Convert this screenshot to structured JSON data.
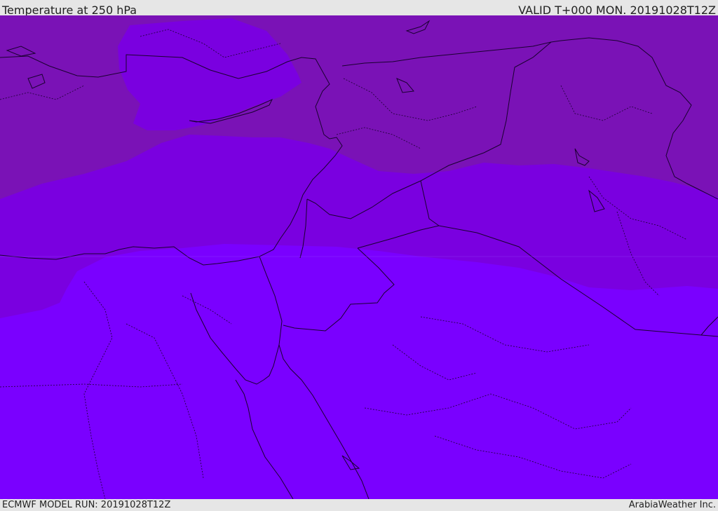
{
  "header": {
    "title": "Temperature at 250 hPa",
    "valid": "VALID T+000 MON. 20191028T12Z"
  },
  "footer": {
    "model_run": "ECMWF MODEL RUN: 20191028T12Z",
    "credit": "ArabiaWeather Inc."
  },
  "colors": {
    "band_cold": "#7a12b6",
    "band_mid": "#7a00e0",
    "band_warm": "#7a00ff",
    "border": "#1a0030",
    "background": "#e6e6e6"
  }
}
